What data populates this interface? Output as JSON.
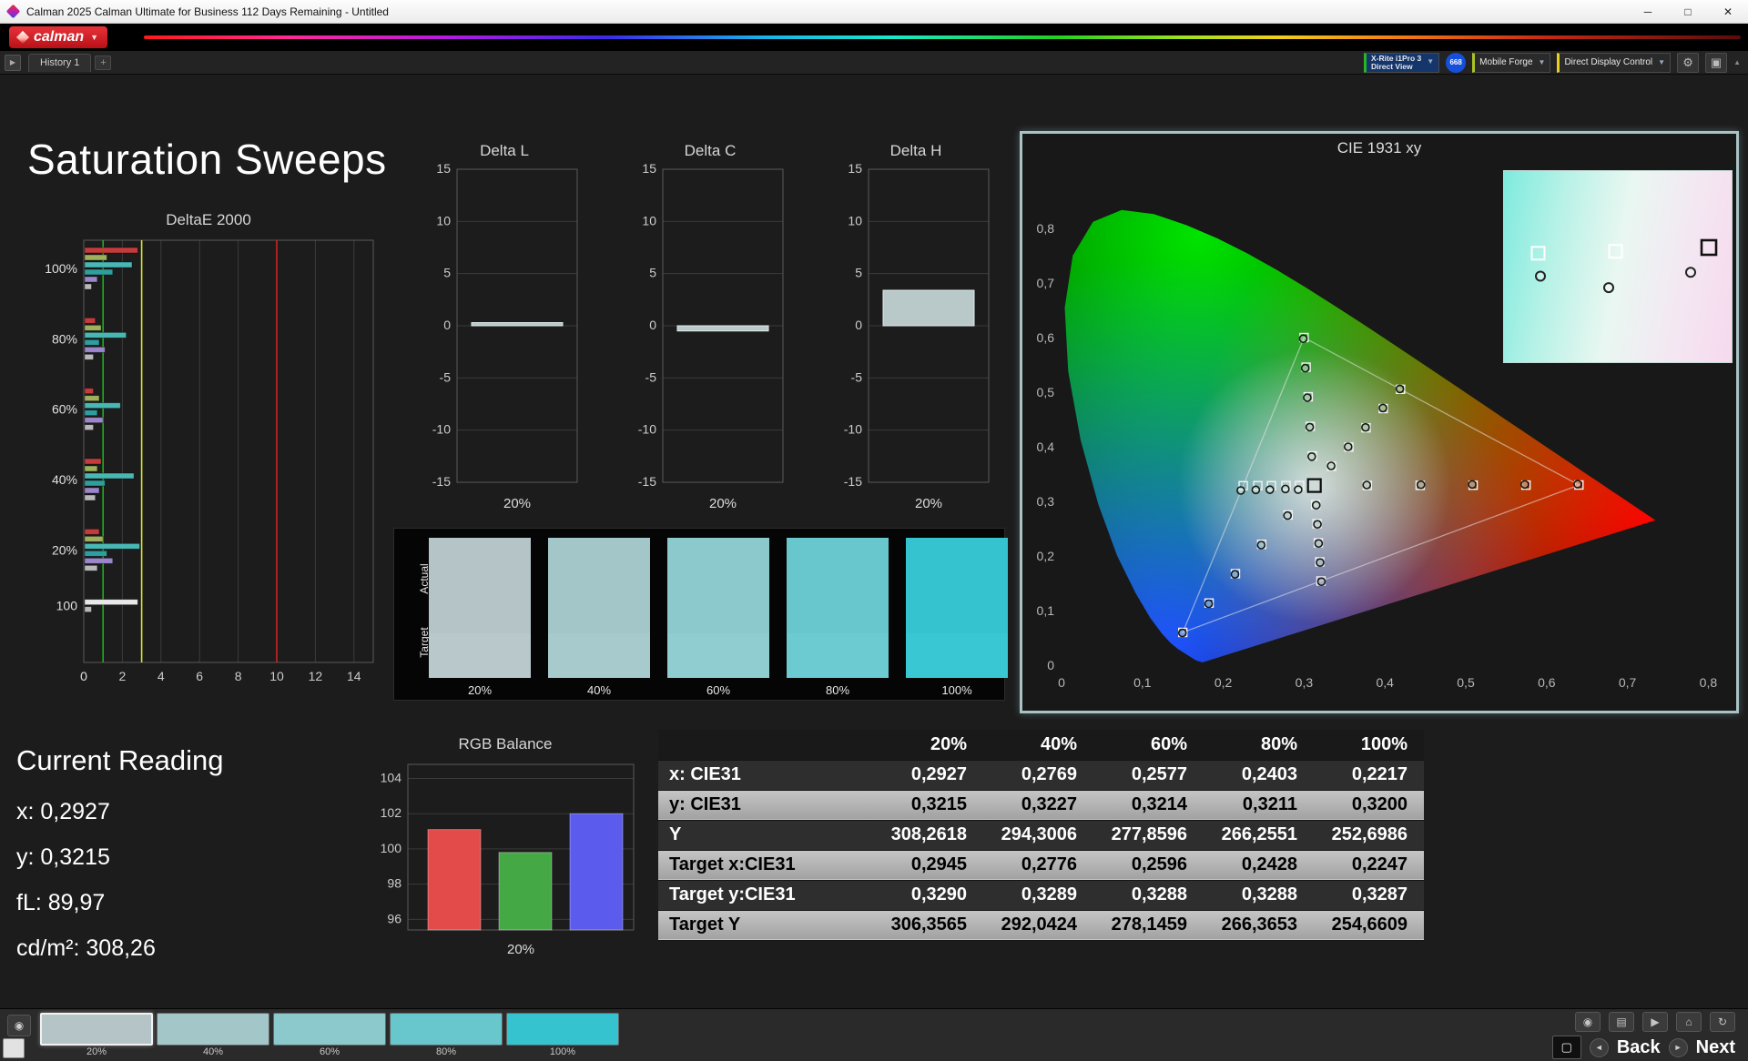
{
  "window": {
    "title": "Calman 2025 Calman Ultimate for Business 112 Days Remaining  - Untitled"
  },
  "brand": {
    "logo_text": "calman"
  },
  "icons": {
    "caret_down": "▼",
    "collapse_arrow": "▶",
    "plus": "+",
    "gear": "⚙",
    "panel": "▣",
    "up_arrow": "▲",
    "eye": "◉",
    "grid": "▤",
    "play": "▶",
    "home": "⌂",
    "refresh": "↻",
    "back_arrow": "◄",
    "next_arrow": "►",
    "screen": "▢",
    "minimize": "─",
    "maximize": "□",
    "close": "✕"
  },
  "toolbar": {
    "history_tab": "History 1",
    "meter_dropdown": {
      "line1": "X-Rite i1Pro 3",
      "line2": "Direct View"
    },
    "meter_badge": "668",
    "source_dropdown": "Mobile Forge",
    "display_dropdown": "Direct Display Control"
  },
  "page": {
    "title": "Saturation Sweeps"
  },
  "current_reading": {
    "title": "Current Reading",
    "x": "x: 0,2927",
    "y": "y: 0,3215",
    "fl": "fL: 89,97",
    "cdm2": "cd/m²: 308,26"
  },
  "footer": {
    "back_label": "Back",
    "next_label": "Next",
    "thumbnails": [
      {
        "label": "20%",
        "color": "#b5c4c6"
      },
      {
        "label": "40%",
        "color": "#a3c6c9"
      },
      {
        "label": "60%",
        "color": "#8bc9cc"
      },
      {
        "label": "80%",
        "color": "#68c6cd"
      },
      {
        "label": "100%",
        "color": "#35c3cf"
      }
    ]
  },
  "chart_data": [
    {
      "id": "deltae2000",
      "type": "bar",
      "orientation": "horizontal",
      "title": "DeltaE 2000",
      "xlim": [
        0,
        15
      ],
      "xticks": [
        0,
        2,
        4,
        6,
        8,
        10,
        12,
        14
      ],
      "reference_lines": [
        {
          "value": 1,
          "color": "#1fae1f"
        },
        {
          "value": 3,
          "color": "#d6e62c"
        },
        {
          "value": 10,
          "color": "#d22222"
        }
      ],
      "groups": [
        {
          "label": "100%",
          "bars": [
            {
              "color": "#c43b3b",
              "value": 2.8
            },
            {
              "color": "#9fb05c",
              "value": 1.2
            },
            {
              "color": "#49b8b4",
              "value": 2.5
            },
            {
              "color": "#2f9e9e",
              "value": 1.5
            },
            {
              "color": "#9b86c9",
              "value": 0.7
            },
            {
              "color": "#b9b9b9",
              "value": 0.4
            }
          ]
        },
        {
          "label": "80%",
          "bars": [
            {
              "color": "#c43b3b",
              "value": 0.6
            },
            {
              "color": "#9fb05c",
              "value": 0.9
            },
            {
              "color": "#49b8b4",
              "value": 2.2
            },
            {
              "color": "#2f9e9e",
              "value": 0.8
            },
            {
              "color": "#9b86c9",
              "value": 1.1
            },
            {
              "color": "#b9b9b9",
              "value": 0.5
            }
          ]
        },
        {
          "label": "60%",
          "bars": [
            {
              "color": "#c43b3b",
              "value": 0.5
            },
            {
              "color": "#9fb05c",
              "value": 0.8
            },
            {
              "color": "#49b8b4",
              "value": 1.9
            },
            {
              "color": "#2f9e9e",
              "value": 0.7
            },
            {
              "color": "#9b86c9",
              "value": 1.0
            },
            {
              "color": "#b9b9b9",
              "value": 0.5
            }
          ]
        },
        {
          "label": "40%",
          "bars": [
            {
              "color": "#c43b3b",
              "value": 0.9
            },
            {
              "color": "#9fb05c",
              "value": 0.7
            },
            {
              "color": "#49b8b4",
              "value": 2.6
            },
            {
              "color": "#2f9e9e",
              "value": 1.1
            },
            {
              "color": "#9b86c9",
              "value": 0.8
            },
            {
              "color": "#b9b9b9",
              "value": 0.6
            }
          ]
        },
        {
          "label": "20%",
          "bars": [
            {
              "color": "#c43b3b",
              "value": 0.8
            },
            {
              "color": "#9fb05c",
              "value": 1.0
            },
            {
              "color": "#49b8b4",
              "value": 2.9
            },
            {
              "color": "#2f9e9e",
              "value": 1.2
            },
            {
              "color": "#9b86c9",
              "value": 1.5
            },
            {
              "color": "#b9b9b9",
              "value": 0.7
            }
          ]
        },
        {
          "label": "100",
          "bars": [
            {
              "color": "#e8e8e8",
              "value": 2.8
            },
            {
              "color": "#b9b9b9",
              "value": 0.4
            }
          ]
        }
      ]
    },
    {
      "id": "delta_l",
      "type": "bar",
      "title": "Delta L",
      "ylim": [
        -15,
        15
      ],
      "yticks": [
        -15,
        -10,
        -5,
        0,
        5,
        10,
        15
      ],
      "value": 0.3,
      "bar_color": "#b9c8c8",
      "xlabel": "20%"
    },
    {
      "id": "delta_c",
      "type": "bar",
      "title": "Delta C",
      "ylim": [
        -15,
        15
      ],
      "yticks": [
        -15,
        -10,
        -5,
        0,
        5,
        10,
        15
      ],
      "value": -0.5,
      "bar_color": "#b9c8c8",
      "xlabel": "20%"
    },
    {
      "id": "delta_h",
      "type": "bar",
      "title": "Delta H",
      "ylim": [
        -15,
        15
      ],
      "yticks": [
        -15,
        -10,
        -5,
        0,
        5,
        10,
        15
      ],
      "value": 3.4,
      "bar_color": "#b9c8c8",
      "xlabel": "20%"
    },
    {
      "id": "rgb_balance",
      "type": "bar",
      "title": "RGB Balance",
      "ylim": [
        95.4,
        104.8
      ],
      "yticks": [
        96,
        98,
        100,
        102,
        104
      ],
      "xlabel": "20%",
      "series": [
        {
          "name": "Red",
          "value": 101.1,
          "color": "#e34a4a"
        },
        {
          "name": "Green",
          "value": 99.8,
          "color": "#44a944"
        },
        {
          "name": "Blue",
          "value": 102.0,
          "color": "#5b5bed"
        }
      ]
    },
    {
      "id": "cie1931",
      "type": "scatter",
      "title": "CIE 1931 xy",
      "xlim": [
        0,
        0.85
      ],
      "ylim": [
        0,
        0.88
      ],
      "xticks": [
        "0",
        "0,1",
        "0,2",
        "0,3",
        "0,4",
        "0,5",
        "0,6",
        "0,7",
        "0,8"
      ],
      "yticks": [
        "0",
        "0,1",
        "0,2",
        "0,3",
        "0,4",
        "0,5",
        "0,6",
        "0,7",
        "0,8"
      ],
      "gamut_triangle": [
        [
          0.64,
          0.33
        ],
        [
          0.3,
          0.6
        ],
        [
          0.15,
          0.06
        ]
      ],
      "white_point": [
        0.3127,
        0.329
      ],
      "targets": [
        [
          0.3782,
          0.3292
        ],
        [
          0.4436,
          0.3294
        ],
        [
          0.5091,
          0.3296
        ],
        [
          0.5745,
          0.3298
        ],
        [
          0.64,
          0.33
        ],
        [
          0.3102,
          0.3832
        ],
        [
          0.3076,
          0.4374
        ],
        [
          0.3051,
          0.4916
        ],
        [
          0.3025,
          0.5458
        ],
        [
          0.3,
          0.6
        ],
        [
          0.2802,
          0.2752
        ],
        [
          0.2476,
          0.2214
        ],
        [
          0.2151,
          0.1676
        ],
        [
          0.1825,
          0.1138
        ],
        [
          0.15,
          0.06
        ],
        [
          0.2945,
          0.329
        ],
        [
          0.2776,
          0.3289
        ],
        [
          0.2596,
          0.3288
        ],
        [
          0.2428,
          0.3288
        ],
        [
          0.2247,
          0.3287
        ],
        [
          0.3143,
          0.294
        ],
        [
          0.316,
          0.2591
        ],
        [
          0.3176,
          0.2241
        ],
        [
          0.3193,
          0.1892
        ],
        [
          0.3209,
          0.1542
        ],
        [
          0.334,
          0.3643
        ],
        [
          0.3553,
          0.3995
        ],
        [
          0.3766,
          0.4348
        ],
        [
          0.398,
          0.47
        ],
        [
          0.4193,
          0.5053
        ]
      ],
      "measured": [
        [
          0.3775,
          0.33
        ],
        [
          0.4445,
          0.3305
        ],
        [
          0.508,
          0.331
        ],
        [
          0.573,
          0.331
        ],
        [
          0.6385,
          0.3315
        ],
        [
          0.3095,
          0.382
        ],
        [
          0.307,
          0.436
        ],
        [
          0.304,
          0.49
        ],
        [
          0.3015,
          0.544
        ],
        [
          0.299,
          0.598
        ],
        [
          0.2795,
          0.274
        ],
        [
          0.247,
          0.22
        ],
        [
          0.2145,
          0.1665
        ],
        [
          0.182,
          0.1125
        ],
        [
          0.1495,
          0.059
        ],
        [
          0.2927,
          0.3215
        ],
        [
          0.2769,
          0.3227
        ],
        [
          0.2577,
          0.3214
        ],
        [
          0.2403,
          0.3211
        ],
        [
          0.2217,
          0.32
        ],
        [
          0.315,
          0.293
        ],
        [
          0.3165,
          0.258
        ],
        [
          0.318,
          0.223
        ],
        [
          0.3198,
          0.188
        ],
        [
          0.3215,
          0.153
        ],
        [
          0.3335,
          0.365
        ],
        [
          0.3545,
          0.4
        ],
        [
          0.376,
          0.4355
        ],
        [
          0.3975,
          0.471
        ],
        [
          0.4185,
          0.506
        ]
      ],
      "inset": {
        "squares": [
          [
            0.15,
            0.43
          ],
          [
            0.49,
            0.42
          ]
        ],
        "current_square": [
          0.9,
          0.4
        ],
        "circles": [
          [
            0.16,
            0.55
          ],
          [
            0.46,
            0.61
          ],
          [
            0.82,
            0.53
          ]
        ]
      }
    },
    {
      "id": "saturation_swatches",
      "type": "swatches",
      "row_labels": [
        "Actual",
        "Target"
      ],
      "columns": [
        {
          "label": "20%",
          "actual": "#b5c4c6",
          "target": "#b9c8ca"
        },
        {
          "label": "40%",
          "actual": "#a3c6c9",
          "target": "#a7cacd"
        },
        {
          "label": "60%",
          "actual": "#8bc9cc",
          "target": "#8fcdd0"
        },
        {
          "label": "80%",
          "actual": "#68c6cd",
          "target": "#6ccad1"
        },
        {
          "label": "100%",
          "actual": "#35c3cf",
          "target": "#39c7d3"
        }
      ]
    },
    {
      "id": "measurement_table",
      "type": "table",
      "columns": [
        "20%",
        "40%",
        "60%",
        "80%",
        "100%"
      ],
      "rows": [
        {
          "label": "x: CIE31",
          "values": [
            "0,2927",
            "0,2769",
            "0,2577",
            "0,2403",
            "0,2217"
          ]
        },
        {
          "label": "y: CIE31",
          "values": [
            "0,3215",
            "0,3227",
            "0,3214",
            "0,3211",
            "0,3200"
          ]
        },
        {
          "label": "Y",
          "values": [
            "308,2618",
            "294,3006",
            "277,8596",
            "266,2551",
            "252,6986"
          ]
        },
        {
          "label": "Target x:CIE31",
          "values": [
            "0,2945",
            "0,2776",
            "0,2596",
            "0,2428",
            "0,2247"
          ]
        },
        {
          "label": "Target y:CIE31",
          "values": [
            "0,3290",
            "0,3289",
            "0,3288",
            "0,3288",
            "0,3287"
          ]
        },
        {
          "label": "Target Y",
          "values": [
            "306,3565",
            "292,0424",
            "278,1459",
            "266,3653",
            "254,6609"
          ]
        }
      ]
    }
  ]
}
